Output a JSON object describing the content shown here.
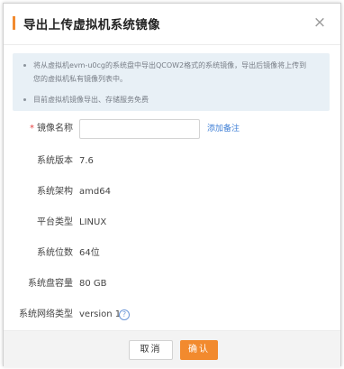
{
  "dialog": {
    "title": "导出上传虚拟机系统镜像",
    "close_glyph": "×"
  },
  "notice": {
    "line1": "将从虚拟机evm-u0cg的系统盘中导出QCOW2格式的系统镜像，导出后镜像将上传到",
    "line1b": "您的虚拟机私有镜像列表中。",
    "line2": "目前虚拟机镜像导出、存储服务免费"
  },
  "form": {
    "image_name": {
      "label": "镜像名称",
      "required_mark": "*",
      "value": "",
      "placeholder": "",
      "add_note": "添加备注"
    },
    "os_version": {
      "label": "系统版本",
      "value": "7.6"
    },
    "os_arch": {
      "label": "系统架构",
      "value": "amd64"
    },
    "platform": {
      "label": "平台类型",
      "value": "LINUX"
    },
    "os_bits": {
      "label": "系统位数",
      "value": "64位"
    },
    "disk_size": {
      "label": "系统盘容量",
      "value": "80 GB"
    },
    "net_type": {
      "label": "系统网络类型",
      "value": "version 1",
      "help_glyph": "?"
    }
  },
  "footer": {
    "cancel_label": "取消",
    "ok_label": "确认"
  },
  "colors": {
    "accent": "#f28a2e",
    "link": "#3f7fd6",
    "notice_bg": "#e8f0f6",
    "required": "#e64545"
  }
}
